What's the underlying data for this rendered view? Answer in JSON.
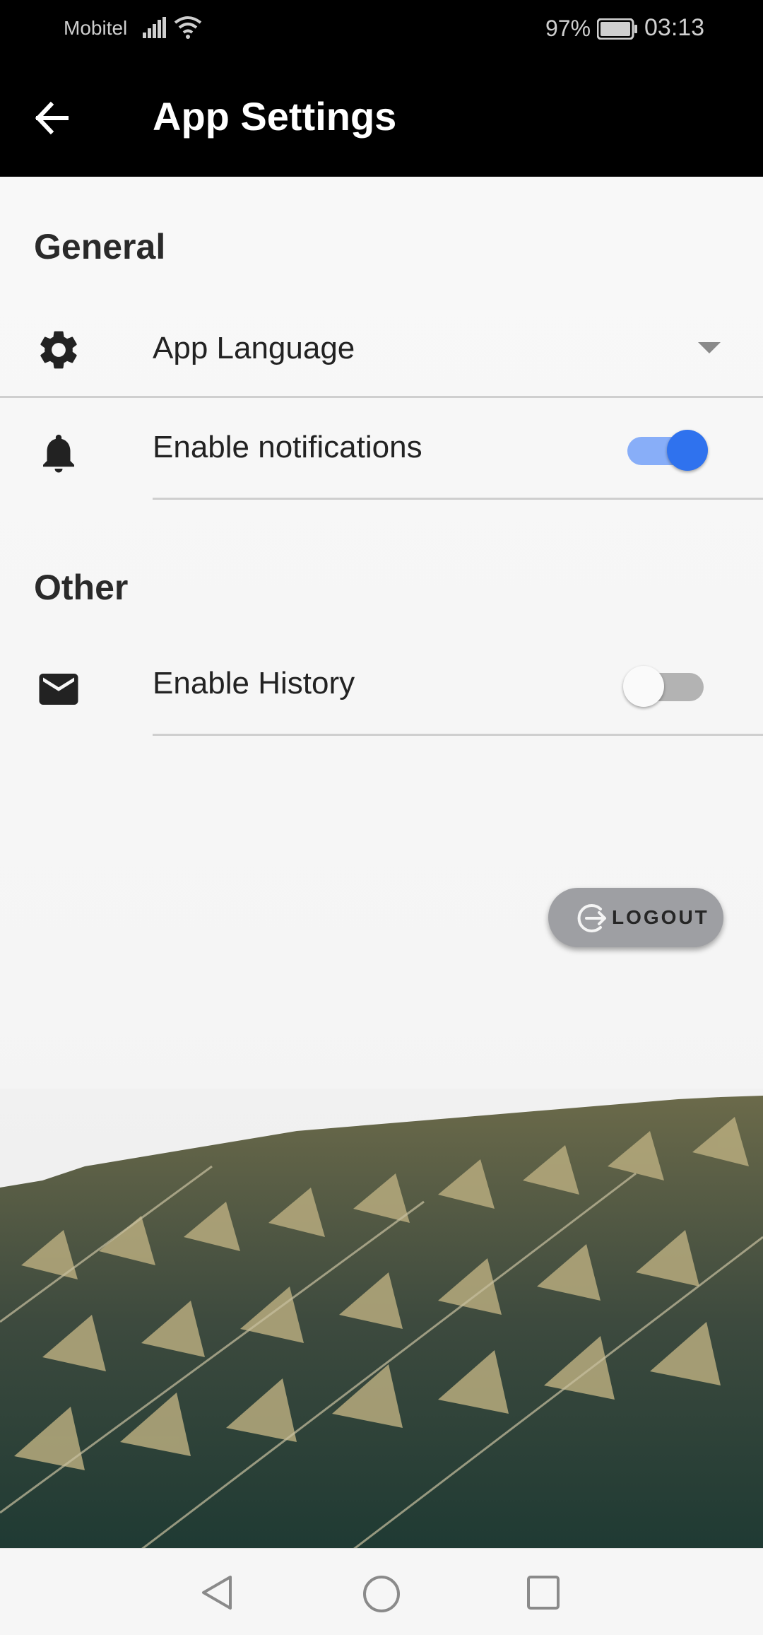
{
  "status_bar": {
    "carrier": "Mobitel",
    "battery_percent": "97%",
    "time": "03:13"
  },
  "app_bar": {
    "title": "App Settings",
    "back_icon": "arrow-left-icon",
    "background": "#000000"
  },
  "sections": [
    {
      "title": "General",
      "items": [
        {
          "icon": "gear-icon",
          "label": "App Language",
          "control": "dropdown"
        },
        {
          "icon": "bell-icon",
          "label": "Enable notifications",
          "control": "toggle",
          "value": true
        }
      ]
    },
    {
      "title": "Other",
      "items": [
        {
          "icon": "envelope-icon",
          "label": "Enable History",
          "control": "toggle",
          "value": false
        }
      ]
    }
  ],
  "logout_button": {
    "label": "LOGOUT",
    "icon": "logout-icon"
  },
  "colors": {
    "accent": "#2f72ee",
    "accent_track": "#88aef8",
    "logout_bg": "#9e9fa3"
  },
  "nav_bar": {
    "back": "nav-back-icon",
    "home": "nav-home-icon",
    "recent": "nav-recent-icon"
  }
}
